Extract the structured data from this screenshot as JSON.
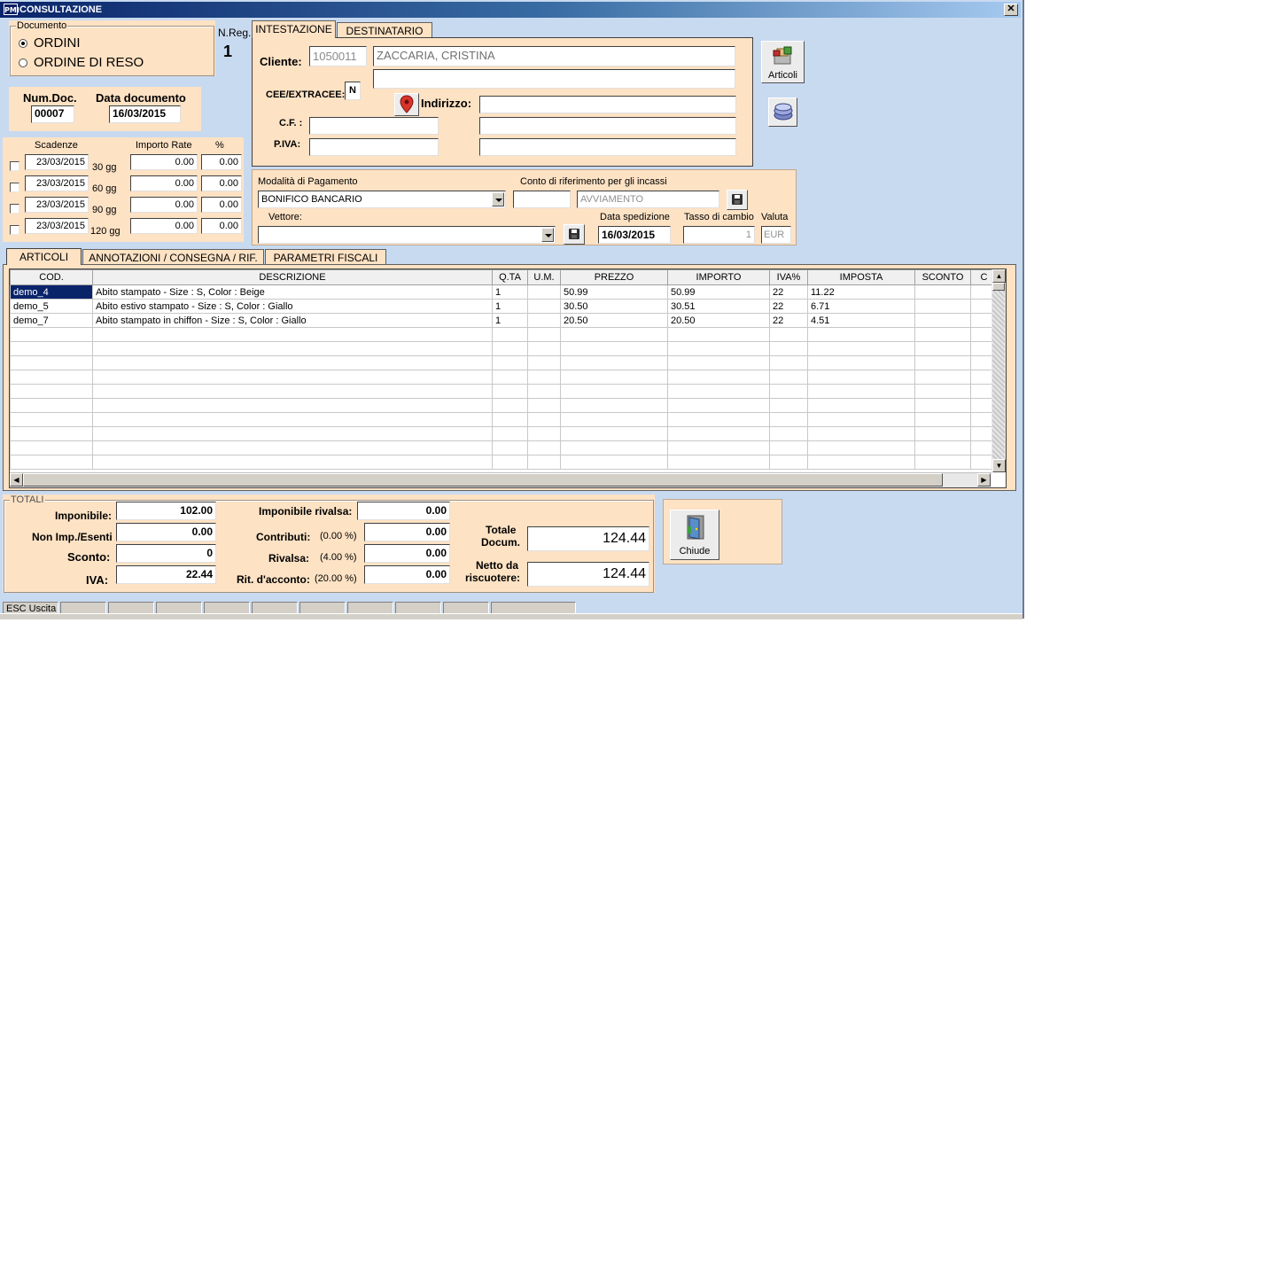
{
  "window": {
    "title": "CONSULTAZIONE",
    "app_icon": "PMI",
    "close": "✕"
  },
  "documento": {
    "legend": "Documento",
    "options": [
      {
        "label": "ORDINI",
        "selected": true
      },
      {
        "label": "ORDINE DI RESO",
        "selected": false
      }
    ]
  },
  "nreg": {
    "label": "N.Reg.",
    "value": "1"
  },
  "doc": {
    "num_label": "Num.Doc.",
    "num_value": "00007",
    "date_label": "Data documento",
    "date_value": "16/03/2015"
  },
  "scadenze": {
    "headers": [
      "Scadenze",
      "Importo Rate",
      "%"
    ],
    "rows": [
      {
        "date": "23/03/2015",
        "days": "30 gg",
        "amount": "0.00",
        "pct": "0.00"
      },
      {
        "date": "23/03/2015",
        "days": "60 gg",
        "amount": "0.00",
        "pct": "0.00"
      },
      {
        "date": "23/03/2015",
        "days": "90 gg",
        "amount": "0.00",
        "pct": "0.00"
      },
      {
        "date": "23/03/2015",
        "days": "120 gg",
        "amount": "0.00",
        "pct": "0.00"
      }
    ]
  },
  "header_tabs": [
    "INTESTAZIONE",
    "DESTINATARIO"
  ],
  "cliente": {
    "label": "Cliente:",
    "code": "1050011",
    "name": "ZACCARIA, CRISTINA",
    "cee_label": "CEE/EXTRACEE:",
    "cee_value": "N",
    "indirizzo_label": "Indirizzo:",
    "cf_label": "C.F. :",
    "piva_label": "P.IVA:"
  },
  "side_buttons": {
    "articoli": "Articoli"
  },
  "pagamento": {
    "label": "Modalità di Pagamento",
    "value": "BONIFICO BANCARIO",
    "conto_label": "Conto di riferimento per gli incassi",
    "conto_value": "AVVIAMENTO",
    "vettore_label": "Vettore:",
    "spedizione_label": "Data spedizione",
    "spedizione_value": "16/03/2015",
    "cambio_label": "Tasso di cambio",
    "cambio_value": "1",
    "valuta_label": "Valuta",
    "valuta_value": "EUR"
  },
  "body_tabs": [
    "ARTICOLI",
    "ANNOTAZIONI / CONSEGNA  / RIF.",
    "PARAMETRI FISCALI"
  ],
  "grid": {
    "columns": [
      "COD.",
      "DESCRIZIONE",
      "Q.TA",
      "U.M.",
      "PREZZO",
      "IMPORTO",
      "IVA%",
      "IMPOSTA",
      "SCONTO",
      "C"
    ],
    "rows": [
      [
        "demo_4",
        "Abito stampato - Size : S, Color : Beige",
        "1",
        "",
        "50.99",
        "50.99",
        "22",
        "11.22",
        "",
        ""
      ],
      [
        "demo_5",
        "Abito estivo stampato - Size : S, Color : Giallo",
        "1",
        "",
        "30.50",
        "30.51",
        "22",
        "6.71",
        "",
        ""
      ],
      [
        "demo_7",
        "Abito stampato in chiffon - Size : S, Color : Giallo",
        "1",
        "",
        "20.50",
        "20.50",
        "22",
        "4.51",
        "",
        ""
      ]
    ]
  },
  "totali": {
    "legend": "TOTALI",
    "imponibile_label": "Imponibile:",
    "imponibile": "102.00",
    "nonimp_label": "Non Imp./Esenti",
    "nonimp": "0.00",
    "sconto_label": "Sconto:",
    "sconto": "0",
    "iva_label": "IVA:",
    "iva": "22.44",
    "imp_rivalsa_label": "Imponibile rivalsa:",
    "imp_rivalsa": "0.00",
    "contributi_label": "Contributi:",
    "contributi_pct": "(0.00 %)",
    "contributi": "0.00",
    "rivalsa_label": "Rivalsa:",
    "rivalsa_pct": "(4.00 %)",
    "rivalsa": "0.00",
    "ritenuta_label": "Rit. d'acconto:",
    "ritenuta_pct": "(20.00 %)",
    "ritenuta": "0.00",
    "totale_label_1": "Totale",
    "totale_label_2": "Docum.",
    "totale": "124.44",
    "netto_label_1": "Netto da",
    "netto_label_2": "riscuotere:",
    "netto": "124.44"
  },
  "chiude": "Chiude",
  "statusbar": {
    "esc": "ESC Uscita"
  }
}
